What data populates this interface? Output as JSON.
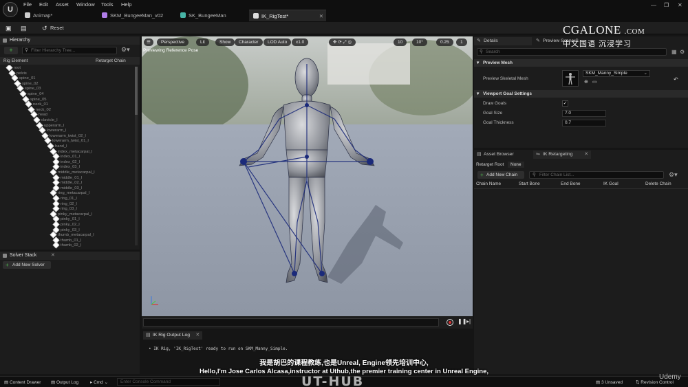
{
  "menu": {
    "items": [
      "File",
      "Edit",
      "Asset",
      "Window",
      "Tools",
      "Help"
    ]
  },
  "tabs": [
    {
      "label": "Animap*",
      "color": "#d0d0d0"
    },
    {
      "label": "SKM_BungeeMan_v02",
      "color": "#b07de8"
    },
    {
      "label": "SK_BungeeMan",
      "color": "#47b4a6"
    },
    {
      "label": "IK_RigTest*",
      "color": "#dddddd"
    }
  ],
  "toolbar": {
    "reset_label": "Reset"
  },
  "hierarchy": {
    "title": "Hierarchy",
    "search_placeholder": "Filter Hierarchy Tree...",
    "col_rig_element": "Rig Element",
    "col_retarget_chain": "Retarget Chain",
    "bones": [
      "root",
      "pelvis",
      "spine_01",
      "spine_02",
      "spine_03",
      "spine_04",
      "spine_05",
      "neck_01",
      "neck_02",
      "head",
      "clavicle_l",
      "upperarm_l",
      "lowerarm_l",
      "lowerarm_twist_02_l",
      "lowerarm_twist_01_l",
      "hand_l",
      "index_metacarpal_l",
      "index_01_l",
      "index_02_l",
      "index_03_l",
      "middle_metacarpal_l",
      "middle_01_l",
      "middle_02_l",
      "middle_03_l",
      "ring_metacarpal_l",
      "ring_01_l",
      "ring_02_l",
      "ring_03_l",
      "pinky_metacarpal_l",
      "pinky_01_l",
      "pinky_02_l",
      "pinky_03_l",
      "thumb_metacarpal_l",
      "thumb_01_l",
      "thumb_02_l"
    ]
  },
  "solver_stack": {
    "title": "Solver Stack",
    "add_label": "Add New Solver"
  },
  "viewport": {
    "buttons": [
      "Perspective",
      "Lit",
      "Show",
      "Character",
      "LOD Auto",
      "x1.0"
    ],
    "right_values": [
      "10",
      "10°",
      "0.25",
      "1"
    ],
    "caption": "Previewing Reference Pose"
  },
  "output_log": {
    "tab": "IK Rig Output Log",
    "line": "IK Rig, 'IK_RigTest' ready to run on SKM_Manny_Simple."
  },
  "details": {
    "tab": "Details",
    "tab2": "Preview Scene S...",
    "search_placeholder": "Search",
    "section_preview_mesh": "Preview Mesh",
    "prop_preview_mesh": "Preview Skeletal Mesh",
    "mesh_value": "SKM_Manny_Simple",
    "section_goal": "Viewport Goal Settings",
    "prop_draw_goals": "Draw Goals",
    "draw_goals": true,
    "prop_goal_size": "Goal Size",
    "goal_size": "7.0",
    "prop_goal_thickness": "Goal Thickness",
    "goal_thickness": "0.7"
  },
  "retarget": {
    "tab_asset_browser": "Asset Browser",
    "tab_ik_retargeting": "IK Retargeting",
    "root_label": "Retarget Root",
    "root_value": "None",
    "add_chain": "Add New Chain",
    "chain_filter_placeholder": "Filter Chain List...",
    "columns": [
      "Chain Name",
      "Start Bone",
      "End Bone",
      "IK Goal",
      "Delete Chain"
    ]
  },
  "statusbar": {
    "content_drawer": "Content Drawer",
    "output_log": "Output Log",
    "cmd": "Cmd",
    "console_placeholder": "Enter Console Command",
    "unsaved": "3 Unsaved",
    "revision_control": "Revision Control"
  },
  "overlay": {
    "watermark_brand": "CGALONE",
    "watermark_suffix": ".COM",
    "watermark_chinese": "中文国语  沉浸学习",
    "subtitle_cn": "我是胡巴的课程教练,也是Unreal, Engine领先培训中心,",
    "subtitle_en": "Hello,I'm Jose Carlos Alcasa,instructor at Uthub,the premier training center in Unreal Engine,",
    "brand": "UT-HUB",
    "udemy": "Udemy"
  },
  "colors": {
    "accent_green": "#4fc34f",
    "record_red": "#d33333",
    "bone_blue": "#1b2a7a"
  }
}
